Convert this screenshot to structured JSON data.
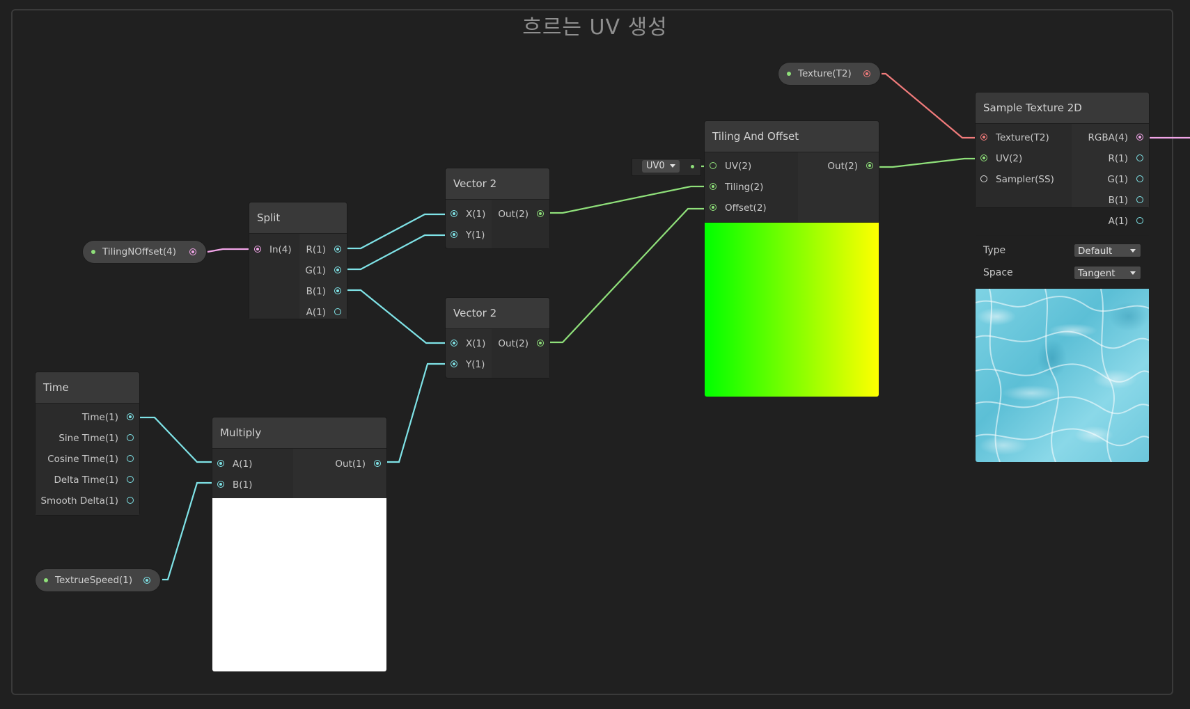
{
  "group": {
    "title": "흐르는 UV 생성"
  },
  "properties": {
    "tiling": {
      "label": "TilingNOffset(4)"
    },
    "texture": {
      "label": "Texture(T2)"
    },
    "speed": {
      "label": "TextrueSpeed(1)"
    }
  },
  "nodes": {
    "split": {
      "title": "Split",
      "inputs": [
        "In(4)"
      ],
      "outputs": [
        "R(1)",
        "G(1)",
        "B(1)",
        "A(1)"
      ]
    },
    "vector2_a": {
      "title": "Vector 2",
      "inputs": [
        "X(1)",
        "Y(1)"
      ],
      "output": "Out(2)"
    },
    "vector2_b": {
      "title": "Vector 2",
      "inputs": [
        "X(1)",
        "Y(1)"
      ],
      "output": "Out(2)"
    },
    "time": {
      "title": "Time",
      "outputs": [
        "Time(1)",
        "Sine Time(1)",
        "Cosine Time(1)",
        "Delta Time(1)",
        "Smooth Delta(1)"
      ]
    },
    "multiply": {
      "title": "Multiply",
      "inputs": [
        "A(1)",
        "B(1)"
      ],
      "output": "Out(1)"
    },
    "tiling_offset": {
      "title": "Tiling And Offset",
      "inputs": [
        "UV(2)",
        "Tiling(2)",
        "Offset(2)"
      ],
      "output": "Out(2)",
      "uv_channel": "UV0"
    },
    "sample_texture": {
      "title": "Sample Texture 2D",
      "inputs": [
        "Texture(T2)",
        "UV(2)",
        "Sampler(SS)"
      ],
      "outputs": [
        "RGBA(4)",
        "R(1)",
        "G(1)",
        "B(1)",
        "A(1)"
      ],
      "type_label": "Type",
      "type_value": "Default",
      "space_label": "Space",
      "space_value": "Tangent"
    }
  },
  "colors": {
    "float_port": "#7fe3e7",
    "vector2_port": "#8fe07a",
    "vector4_port": "#f2a5e8",
    "texture_port": "#f17b7b",
    "background": "#202020"
  }
}
